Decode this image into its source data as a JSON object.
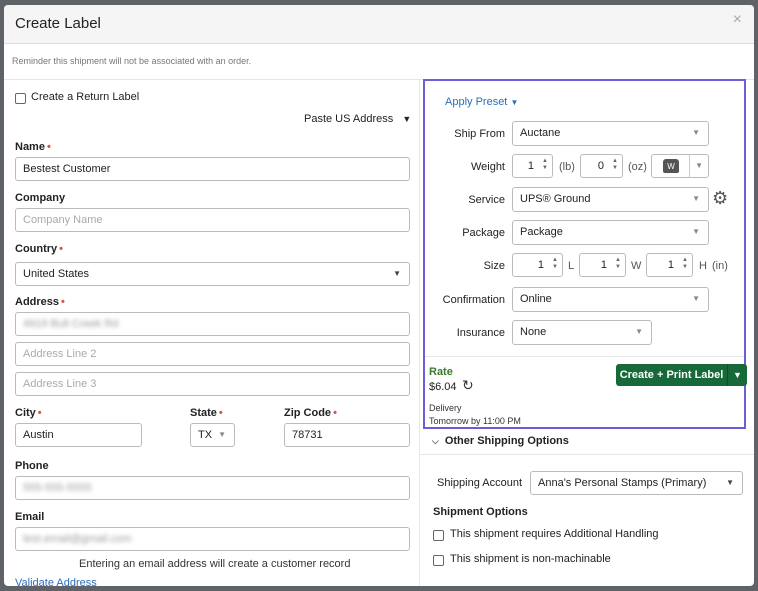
{
  "dialog": {
    "title": "Create Label",
    "close_label": "×",
    "reminder": "Reminder this shipment will not be associated with an order."
  },
  "left": {
    "return_label": "Create a Return Label",
    "paste_address": "Paste US Address",
    "name_label": "Name",
    "name_value": "Bestest Customer",
    "company_label": "Company",
    "company_placeholder": "Company Name",
    "country_label": "Country",
    "country_value": "United States",
    "address_label": "Address",
    "address1_value": "4919 Bull Creek Rd",
    "address2_placeholder": "Address Line 2",
    "address3_placeholder": "Address Line 3",
    "city_label": "City",
    "city_value": "Austin",
    "state_label": "State",
    "state_value": "TX",
    "zip_label": "Zip Code",
    "zip_value": "78731",
    "phone_label": "Phone",
    "phone_value": "555-555-5555",
    "email_label": "Email",
    "email_value": "test.email@gmail.com",
    "email_note": "Entering an email address will create a customer record",
    "validate_link": "Validate Address"
  },
  "right": {
    "apply_preset": "Apply Preset",
    "ship_from_label": "Ship From",
    "ship_from_value": "Auctane",
    "weight_label": "Weight",
    "weight_lb": "1",
    "weight_lb_unit": "(lb)",
    "weight_oz": "0",
    "weight_oz_unit": "(oz)",
    "scale_icon_letter": "W",
    "service_label": "Service",
    "service_value": "UPS® Ground",
    "package_label": "Package",
    "package_value": "Package",
    "size_label": "Size",
    "size_l": "1",
    "size_l_unit": "L",
    "size_w": "1",
    "size_w_unit": "W",
    "size_h": "1",
    "size_h_unit": "H",
    "size_in_unit": "(in)",
    "confirmation_label": "Confirmation",
    "confirmation_value": "Online",
    "insurance_label": "Insurance",
    "insurance_value": "None",
    "rate_label": "Rate",
    "rate_value": "$6.04",
    "delivery_label": "Delivery",
    "delivery_value": "Tomorrow by 11:00 PM",
    "create_button": "Create + Print Label",
    "other_options_title": "Other Shipping Options",
    "shipping_account_label": "Shipping Account",
    "shipping_account_value": "Anna's Personal Stamps (Primary)",
    "shipment_options_title": "Shipment Options",
    "option_additional_handling": "This shipment requires Additional Handling",
    "option_nonmachinable": "This shipment is non-machinable"
  },
  "colors": {
    "accent_green": "#17693a",
    "link_blue": "#2a6ebb",
    "highlight_border": "#6a5fd8",
    "required_red": "#d9534f"
  }
}
